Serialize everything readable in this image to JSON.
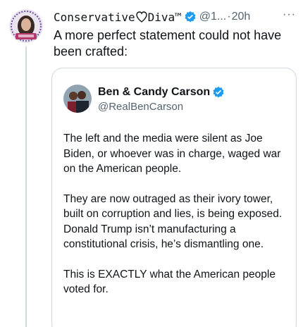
{
  "post": {
    "display_name": "Conservative",
    "display_name_suffix": "Diva™",
    "handle": "@1...",
    "separator": "·",
    "time": "20h",
    "more": "···",
    "text": "A more perfect statement could not have been crafted:"
  },
  "quoted": {
    "display_name": "Ben & Candy Carson",
    "handle": "@RealBenCarson",
    "paragraphs": [
      "The left and the media were silent as Joe Biden, or whoever was in charge, waged war on the American people.",
      "They are now outraged as their ivory tower, built on corruption and lies, is being exposed. Donald Trump isn’t manufacturing a constitutional crisis, he’s dismantling one.",
      "This is EXACTLY what the American people voted for."
    ]
  },
  "colors": {
    "text": "#0f1419",
    "secondary": "#536471",
    "verified": "#1d9bf0",
    "border": "#cfd9de"
  },
  "icons": {
    "verified": "verified-badge-icon",
    "heart_outline": "heart-outline-icon",
    "more": "more-options-icon"
  }
}
